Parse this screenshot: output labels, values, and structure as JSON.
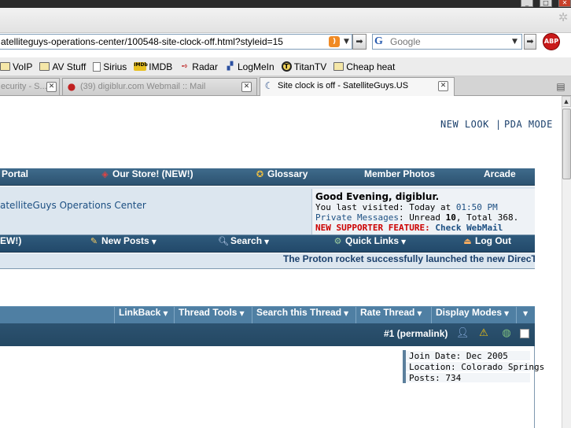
{
  "browser": {
    "url": "atelliteguys-operations-center/100548-site-clock-off.html?styleid=15",
    "search_placeholder": "Google",
    "abp_label": "ABP"
  },
  "bookmarks": [
    {
      "label": "VoIP",
      "icon": "folder-icon"
    },
    {
      "label": "AV Stuff",
      "icon": "folder-icon"
    },
    {
      "label": "Sirius",
      "icon": "page-icon"
    },
    {
      "label": "IMDB",
      "icon": "imdb-icon"
    },
    {
      "label": "Radar",
      "icon": "radar-icon"
    },
    {
      "label": "LogMeIn",
      "icon": "logmein-icon"
    },
    {
      "label": "TitanTV",
      "icon": "titantv-icon"
    },
    {
      "label": "Cheap heat",
      "icon": "folder-icon"
    }
  ],
  "tabs": [
    {
      "label": "ecurity - S...",
      "active": false
    },
    {
      "label": "(39) digiblur.com Webmail :: Mail",
      "active": false
    },
    {
      "label": "Site clock is off - SatelliteGuys.US",
      "active": true
    }
  ],
  "page": {
    "new_look": "NEW LOOK",
    "separator": "|",
    "pda_mode": "PDA MODE",
    "nav1": {
      "portal": "Portal",
      "store": "Our Store! (NEW!)",
      "glossary": "Glossary",
      "member_photos": "Member Photos",
      "arcade": "Arcade"
    },
    "breadcrumb": "atelliteGuys Operations Center",
    "welcome": {
      "greeting": "Good Evening, digiblur.",
      "last_visited_prefix": "You last visited: Today at ",
      "last_visited_time": "01:50 PM",
      "pm_label": "Private Messages",
      "pm_unread_prefix": ": Unread ",
      "pm_unread": "10",
      "pm_total": ", Total 368.",
      "feature_label": "NEW SUPPORTER FEATURE:",
      "feature_link": "Check WebMail"
    },
    "nav2": {
      "new_partial": "EW!)",
      "new_posts": "New Posts",
      "search": "Search",
      "quick_links": "Quick Links",
      "log_out": "Log Out"
    },
    "ticker": "The Proton rocket successfully launched the new DirecT",
    "thread_tools": {
      "linkback": "LinkBack",
      "thread_tools": "Thread Tools",
      "search_thread": "Search this Thread",
      "rate_thread": "Rate Thread",
      "display_modes": "Display Modes"
    },
    "post": {
      "permalink": "#1 (permalink)",
      "join_date": "Join Date: Dec 2005",
      "location": "Location: Colorado Springs",
      "posts": "Posts: 734"
    }
  },
  "colors": {
    "nav_blue": "#2c5270",
    "toolbar_blue": "#4f7fa3",
    "link_blue": "#1c4f82",
    "alert_red": "#cc0000"
  }
}
